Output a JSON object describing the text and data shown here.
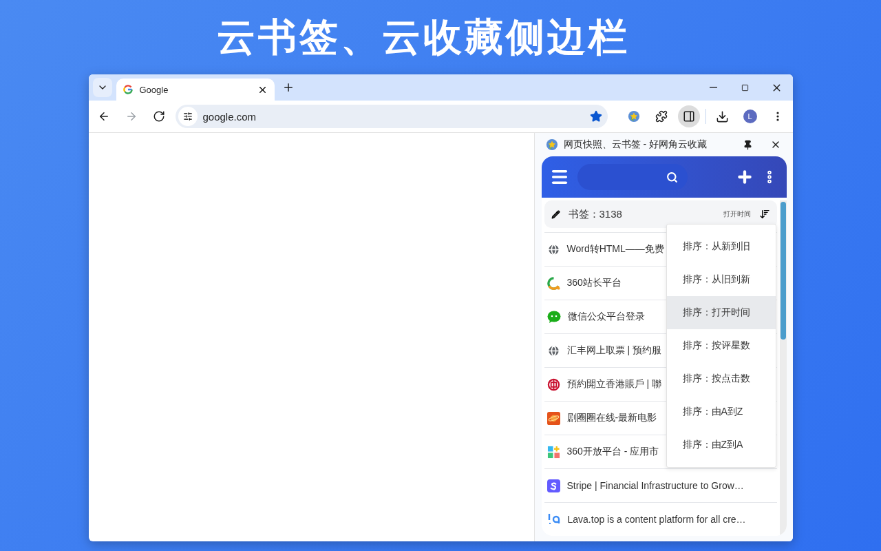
{
  "headline": "云书签、云收藏侧边栏",
  "tab": {
    "title": "Google"
  },
  "nav": [
    {
      "kind": "back",
      "disabled": false
    },
    {
      "kind": "forward",
      "disabled": true
    },
    {
      "kind": "reload",
      "disabled": false
    }
  ],
  "address": {
    "value": "google.com",
    "bookmarked": true
  },
  "avatar": "L",
  "side_panel": {
    "title": "网页快照、云书签 - 好网角云收藏",
    "count_label": "书签：3138",
    "sort_label": "打开时间",
    "bookmarks": [
      {
        "kind": "globe",
        "title": "Word转HTML——免费"
      },
      {
        "kind": "ring",
        "title": "360站长平台"
      },
      {
        "kind": "chat",
        "title": "微信公众平台登录"
      },
      {
        "kind": "globe",
        "title": "汇丰网上取票 | 预约服"
      },
      {
        "kind": "bank",
        "title": "預約開立香港賬戶 | 聯"
      },
      {
        "kind": "planet",
        "title": "剧圈圈在线-最新电影"
      },
      {
        "kind": "tiles",
        "title": "360开放平台 - 应用市"
      },
      {
        "kind": "letter",
        "title": "Stripe | Financial Infrastructure to Grow…"
      },
      {
        "kind": "lava",
        "title": "Lava.top is a content platform for all cre…"
      }
    ],
    "sort_menu": [
      {
        "label": "排序：从新到旧",
        "selected": false
      },
      {
        "label": "排序：从旧到新",
        "selected": false
      },
      {
        "label": "排序：打开时间",
        "selected": true
      },
      {
        "label": "排序：按评星数",
        "selected": false
      },
      {
        "label": "排序：按点击数",
        "selected": false
      },
      {
        "label": "排序：由A到Z",
        "selected": false
      },
      {
        "label": "排序：由Z到A",
        "selected": false
      }
    ]
  }
}
